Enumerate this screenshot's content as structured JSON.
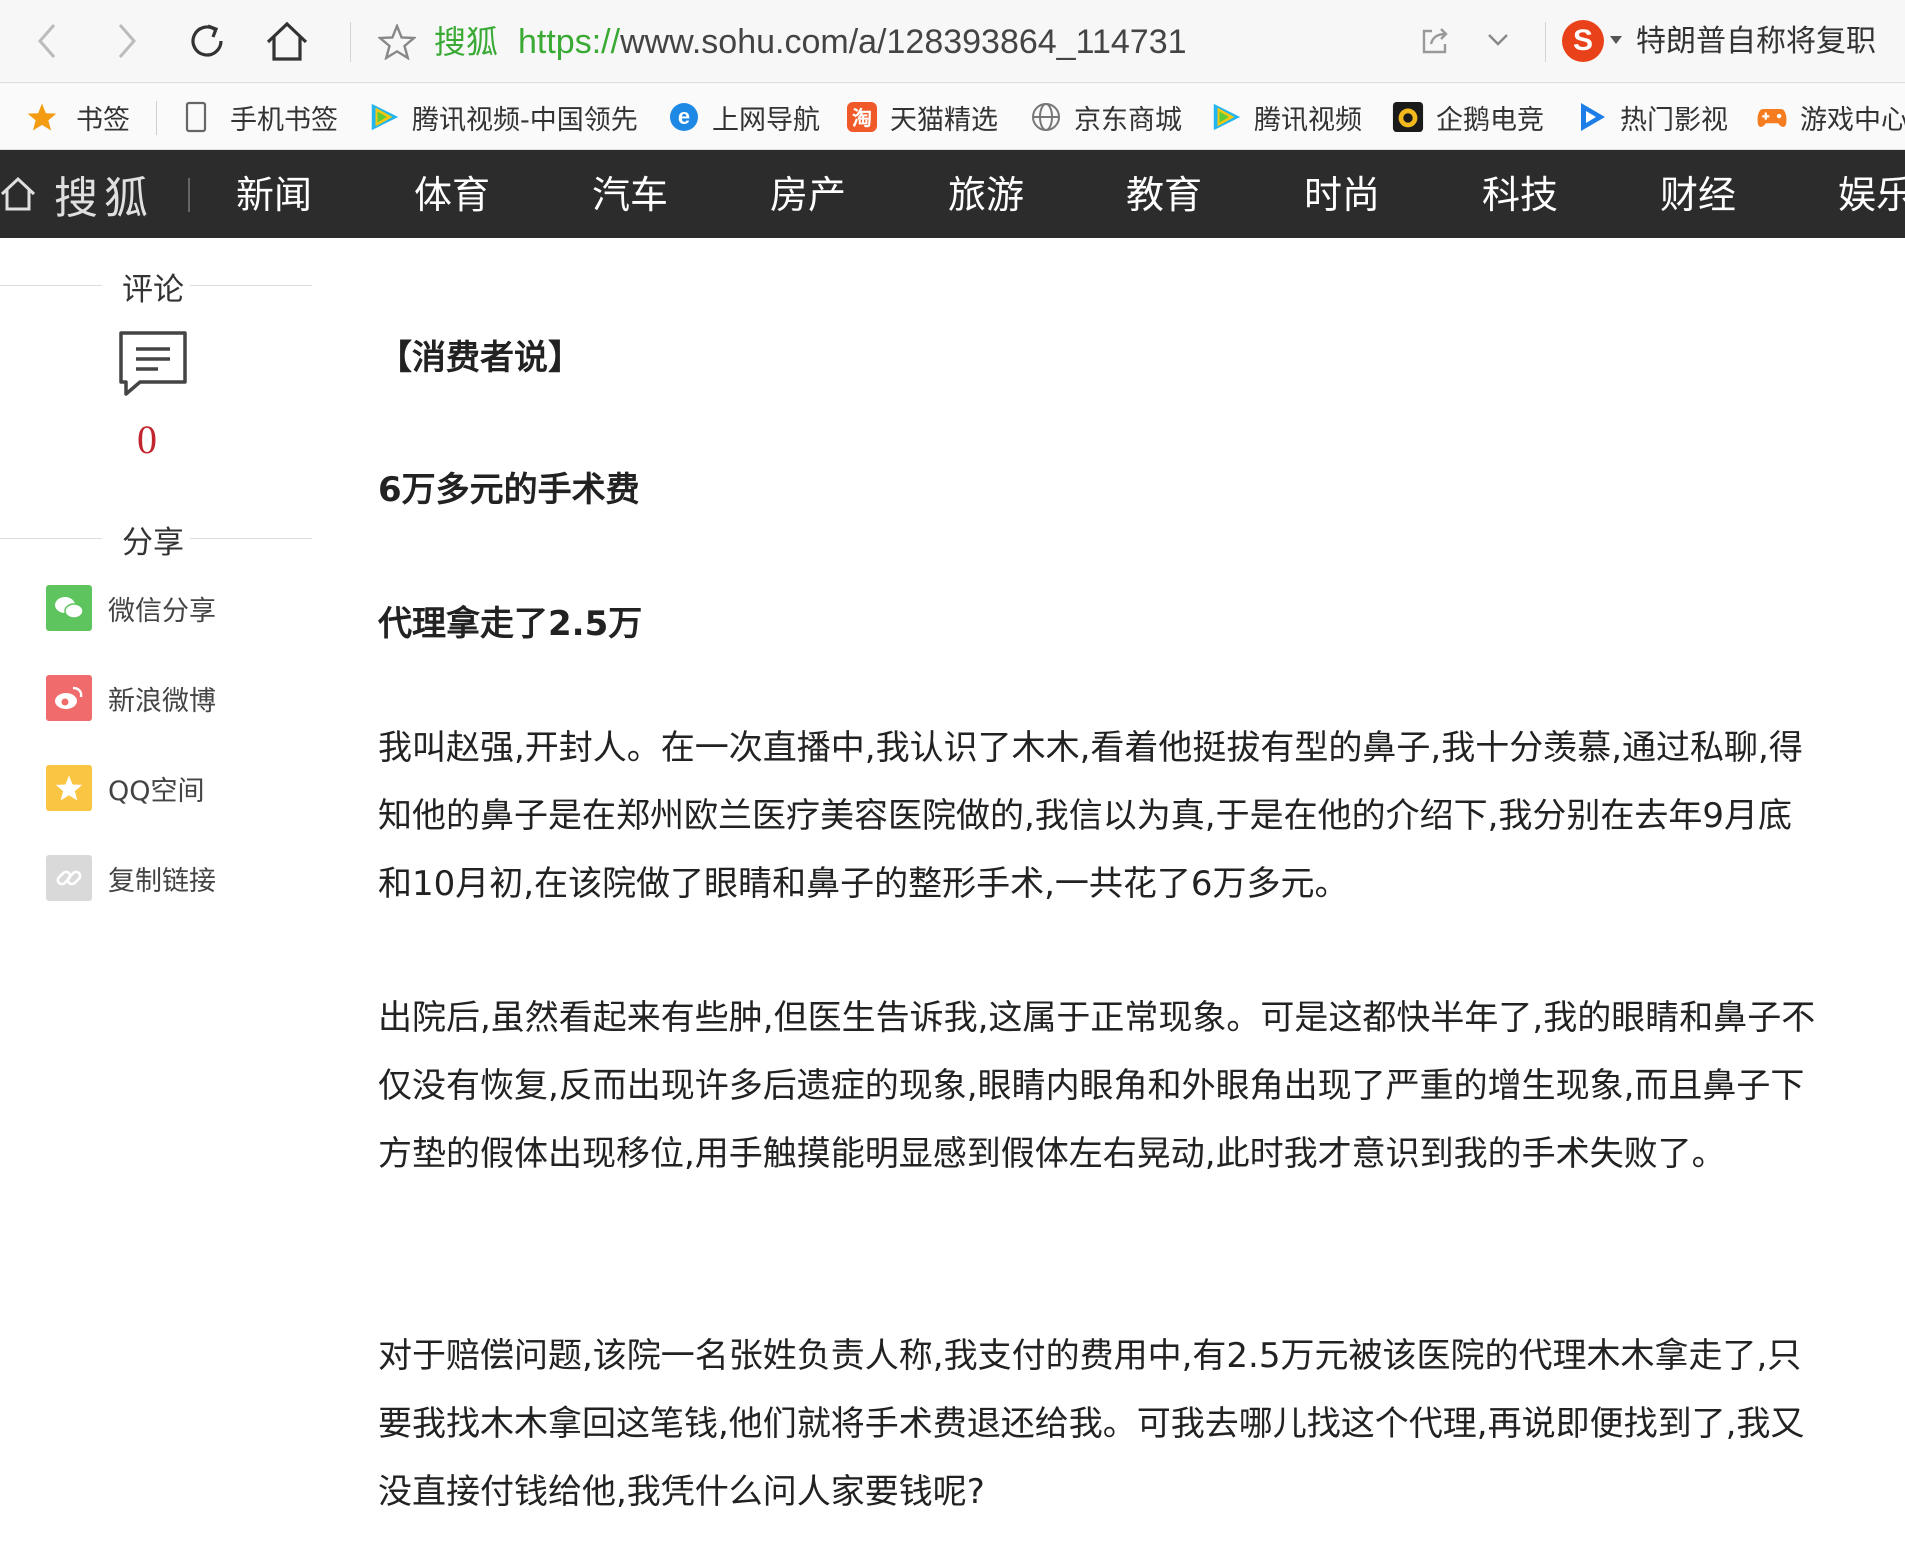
{
  "browser": {
    "site_name": "搜狐",
    "url_protocol": "https://",
    "url_rest": "www.sohu.com/a/128393864_114731",
    "hot_search": "特朗普自称将复职",
    "sogou_letter": "S"
  },
  "bookmarks": [
    {
      "label": "书签",
      "icon": "star-icon"
    },
    {
      "label": "手机书签",
      "icon": "phone-icon"
    },
    {
      "label": "腾讯视频-中国领先",
      "icon": "tencent-video-icon"
    },
    {
      "label": "上网导航",
      "icon": "ie-icon"
    },
    {
      "label": "天猫精选",
      "icon": "tmall-icon"
    },
    {
      "label": "京东商城",
      "icon": "globe-icon"
    },
    {
      "label": "腾讯视频",
      "icon": "tencent-video-icon"
    },
    {
      "label": "企鹅电竞",
      "icon": "penguin-esports-icon"
    },
    {
      "label": "热门影视",
      "icon": "play-icon"
    },
    {
      "label": "游戏中心",
      "icon": "gamepad-icon"
    }
  ],
  "sohu_nav": {
    "logo": "搜狐",
    "items": [
      "新闻",
      "体育",
      "汽车",
      "房产",
      "旅游",
      "教育",
      "时尚",
      "科技",
      "财经",
      "娱乐"
    ]
  },
  "sidebar": {
    "comment_title": "评论",
    "comment_count": "0",
    "share_title": "分享",
    "share_items": [
      {
        "label": "微信分享",
        "color": "#5ec45e",
        "icon": "wechat-icon"
      },
      {
        "label": "新浪微博",
        "color": "#f06b6b",
        "icon": "weibo-icon"
      },
      {
        "label": "QQ空间",
        "color": "#fbc544",
        "icon": "qzone-icon"
      },
      {
        "label": "复制链接",
        "color": "#d9d9d9",
        "icon": "link-icon"
      }
    ]
  },
  "article": {
    "tag": "【消费者说】",
    "heading1": "6万多元的手术费",
    "heading2": "代理拿走了2.5万",
    "paragraphs": [
      "我叫赵强,开封人。在一次直播中,我认识了木木,看着他挺拔有型的鼻子,我十分羡慕,通过私聊,得知他的鼻子是在郑州欧兰医疗美容医院做的,我信以为真,于是在他的介绍下,我分别在去年9月底和10月初,在该院做了眼睛和鼻子的整形手术,一共花了6万多元。",
      "出院后,虽然看起来有些肿,但医生告诉我,这属于正常现象。可是这都快半年了,我的眼睛和鼻子不仅没有恢复,反而出现许多后遗症的现象,眼睛内眼角和外眼角出现了严重的增生现象,而且鼻子下方垫的假体出现移位,用手触摸能明显感到假体左右晃动,此时我才意识到我的手术失败了。",
      "对于赔偿问题,该院一名张姓负责人称,我支付的费用中,有2.5万元被该医院的代理木木拿走了,只要我找木木拿回这笔钱,他们就将手术费退还给我。可我去哪儿找这个代理,再说即便找到了,我又没直接付钱给他,我凭什么问人家要钱呢?"
    ]
  },
  "colors": {
    "accent_green": "#3aaa35",
    "nav_bg": "#2c2c2c",
    "comment_red": "#c1262e"
  }
}
